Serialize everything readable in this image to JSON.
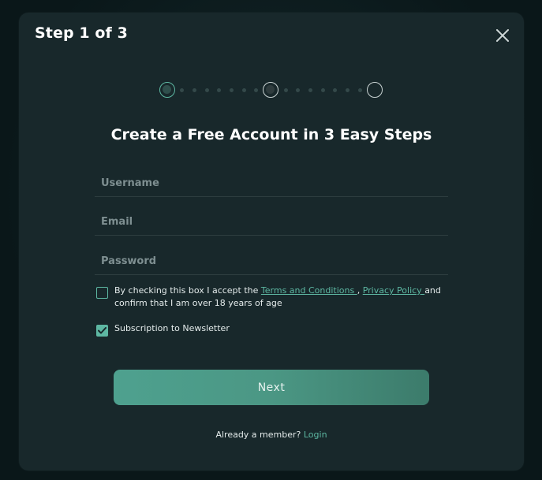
{
  "modal": {
    "title": "Step 1 of 3",
    "heading": "Create a Free Account in 3 Easy Steps",
    "close_icon": "close-icon"
  },
  "stepper": {
    "current_step": 1,
    "total_steps": 3
  },
  "form": {
    "username": {
      "placeholder": "Username",
      "value": ""
    },
    "email": {
      "placeholder": "Email",
      "value": ""
    },
    "password": {
      "placeholder": "Password",
      "value": ""
    },
    "terms": {
      "checked": false,
      "text_before": "By checking this box I accept the",
      "terms_link": "Terms and Conditions ",
      "separator": ",",
      "privacy_link": "Privacy Policy ",
      "text_after": "and confirm that I am over 18 years of age"
    },
    "newsletter": {
      "checked": true,
      "label": "Subscription to Newsletter"
    },
    "next_label": "Next"
  },
  "footer": {
    "text": "Already a member?",
    "login_label": "Login"
  },
  "colors": {
    "accent": "#5db7a2",
    "modal_bg": "#18282b",
    "page_bg": "#0b1a1c"
  }
}
